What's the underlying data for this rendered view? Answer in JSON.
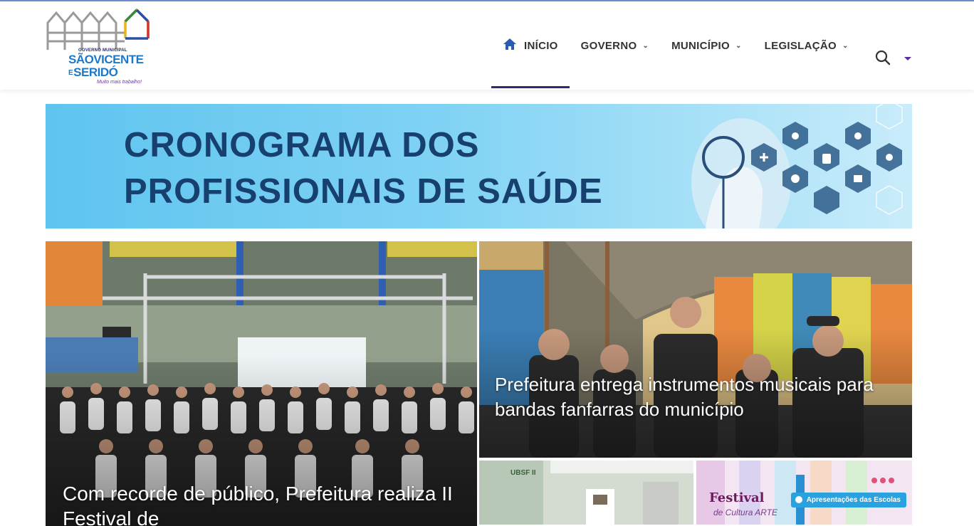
{
  "logo": {
    "top_label": "GOVERNO MUNICIPAL",
    "line1": "SÃOVICENTE",
    "line2": "SERIDÓ",
    "connector": "E",
    "slogan": "Muito mais trabalho!"
  },
  "nav": {
    "items": [
      {
        "label": "INÍCIO",
        "icon": "home-icon",
        "active": true
      },
      {
        "label": "GOVERNO",
        "dropdown": true
      },
      {
        "label": "MUNICÍPIO",
        "dropdown": true
      },
      {
        "label": "LEGISLAÇÃO",
        "dropdown": true
      }
    ],
    "search_icon": "search-icon",
    "extra_icon": "caret-down-icon"
  },
  "banner": {
    "line1": "CRONOGRAMA DOS",
    "line2": "PROFISSIONAIS DE SAÚDE"
  },
  "news": [
    {
      "title": "Com recorde de público, Prefeitura realiza II Festival de"
    },
    {
      "title": "Prefeitura entrega instrumentos musicais para bandas fanfarras do município"
    },
    {
      "title": "",
      "sign": "UBSF II"
    },
    {
      "title": "",
      "festival": "Festival",
      "festival_sub": "de Cultura ARTE",
      "badge": "Apresentações das Escolas"
    }
  ],
  "colors": {
    "accent": "#2c2c6e",
    "banner_text": "#17406f",
    "topline": "#6f8fce"
  }
}
